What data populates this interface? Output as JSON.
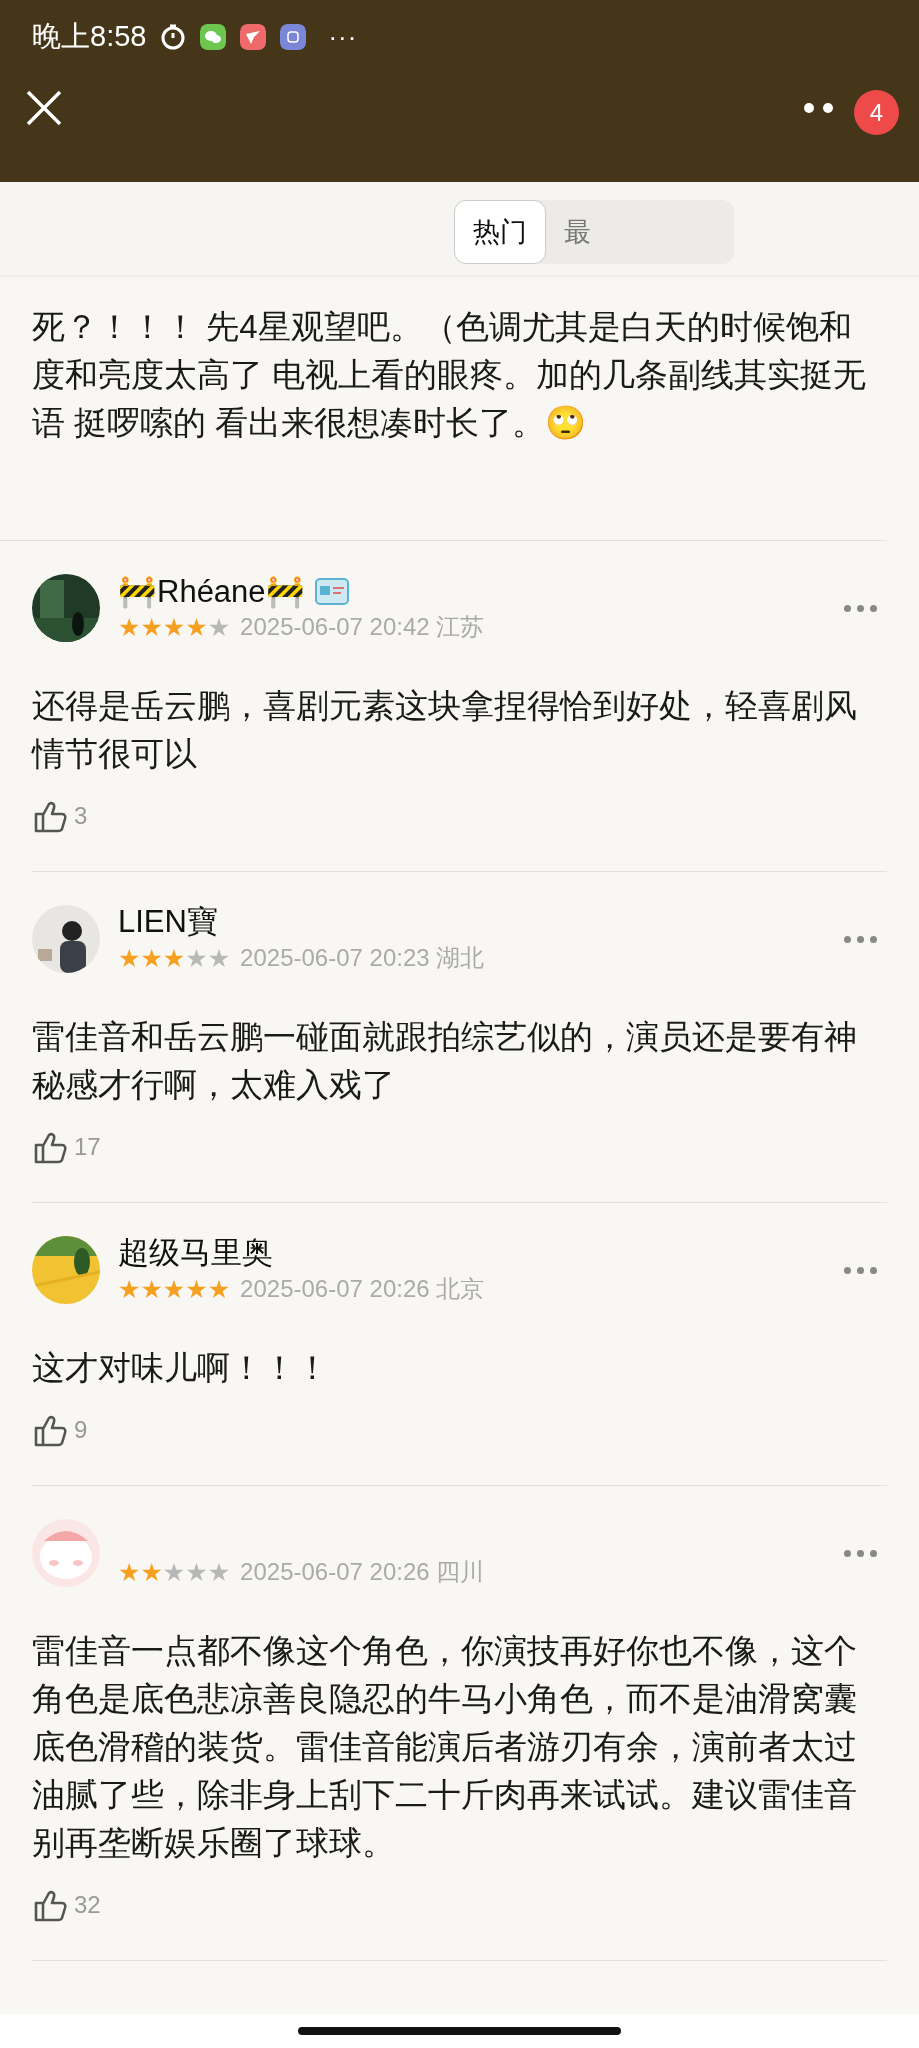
{
  "status_bar": {
    "time": "晚上8:58",
    "overflow": "···"
  },
  "nav": {
    "badge": "4"
  },
  "tabs": [
    {
      "label": "热门",
      "selected": true
    },
    {
      "label": "最",
      "selected": false
    }
  ],
  "partial_review": {
    "text": "死？！！！ 先4星观望吧。（色调尤其是白天的时候饱和度和亮度太高了 电视上看的眼疼。加的几条副线其实挺无语 挺啰嗦的 看出来很想凑时长了。🙄"
  },
  "reviews": [
    {
      "name": "🚧Rhéane🚧",
      "badge": true,
      "stars": 4,
      "time": "2025-06-07 20:42",
      "location": "江苏",
      "text": "还得是岳云鹏，喜剧元素这块拿捏得恰到好处，轻喜剧风情节很可以",
      "likes": "3"
    },
    {
      "name": "LIEN寶",
      "badge": false,
      "stars": 3,
      "time": "2025-06-07 20:23",
      "location": "湖北",
      "text": "雷佳音和岳云鹏一碰面就跟拍综艺似的，演员还是要有神秘感才行啊，太难入戏了",
      "likes": "17"
    },
    {
      "name": "超级马里奥",
      "badge": false,
      "stars": 5,
      "time": "2025-06-07 20:26",
      "location": "北京",
      "text": "这才对味儿啊！！！",
      "likes": "9"
    },
    {
      "stars": 2,
      "badge": false,
      "time": "2025-06-07 20:26",
      "location": "四川",
      "text": "雷佳音一点都不像这个角色，你演技再好你也不像，这个角色是底色悲凉善良隐忍的牛马小角色，而不是油滑窝囊底色滑稽的装货。雷佳音能演后者游刃有余，演前者太过油腻了些，除非身上刮下二十斤肉再来试试。建议雷佳音别再垄断娱乐圈了球球。",
      "likes": "32"
    }
  ]
}
